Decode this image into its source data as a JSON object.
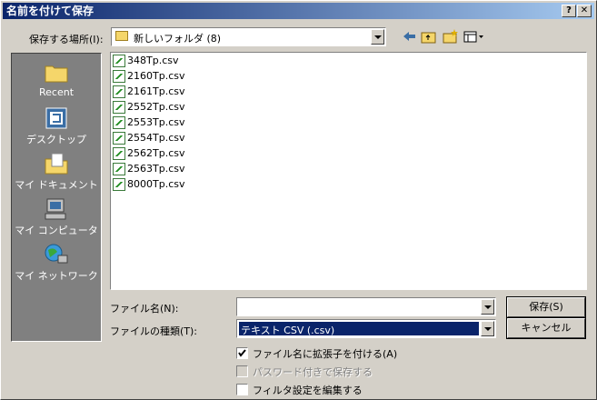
{
  "window": {
    "title": "名前を付けて保存"
  },
  "titlebar_buttons": {
    "help": "?",
    "close": "✕"
  },
  "location": {
    "label": "保存する場所(I):",
    "value": "新しいフォルダ (8)"
  },
  "places": [
    {
      "label": "Recent",
      "icon": "recent-folder-icon"
    },
    {
      "label": "デスクトップ",
      "icon": "desktop-icon"
    },
    {
      "label": "マイ ドキュメント",
      "icon": "my-documents-icon"
    },
    {
      "label": "マイ コンピュータ",
      "icon": "my-computer-icon"
    },
    {
      "label": "マイ ネットワーク",
      "icon": "my-network-icon"
    }
  ],
  "files": [
    "348Tp.csv",
    "2160Tp.csv",
    "2161Tp.csv",
    "2552Tp.csv",
    "2553Tp.csv",
    "2554Tp.csv",
    "2562Tp.csv",
    "2563Tp.csv",
    "8000Tp.csv"
  ],
  "filename": {
    "label": "ファイル名(N):",
    "value": ""
  },
  "filetype": {
    "label": "ファイルの種類(T):",
    "value": "テキスト CSV (.csv)"
  },
  "buttons": {
    "save": "保存(S)",
    "cancel": "キャンセル"
  },
  "options": [
    {
      "label": "ファイル名に拡張子を付ける(A)",
      "checked": true,
      "enabled": true
    },
    {
      "label": "パスワード付きで保存する",
      "checked": false,
      "enabled": false
    },
    {
      "label": "フィルタ設定を編集する",
      "checked": false,
      "enabled": true
    }
  ],
  "colors": {
    "title_start": "#0a246a",
    "title_end": "#a6caf0",
    "selection": "#0a246a"
  }
}
